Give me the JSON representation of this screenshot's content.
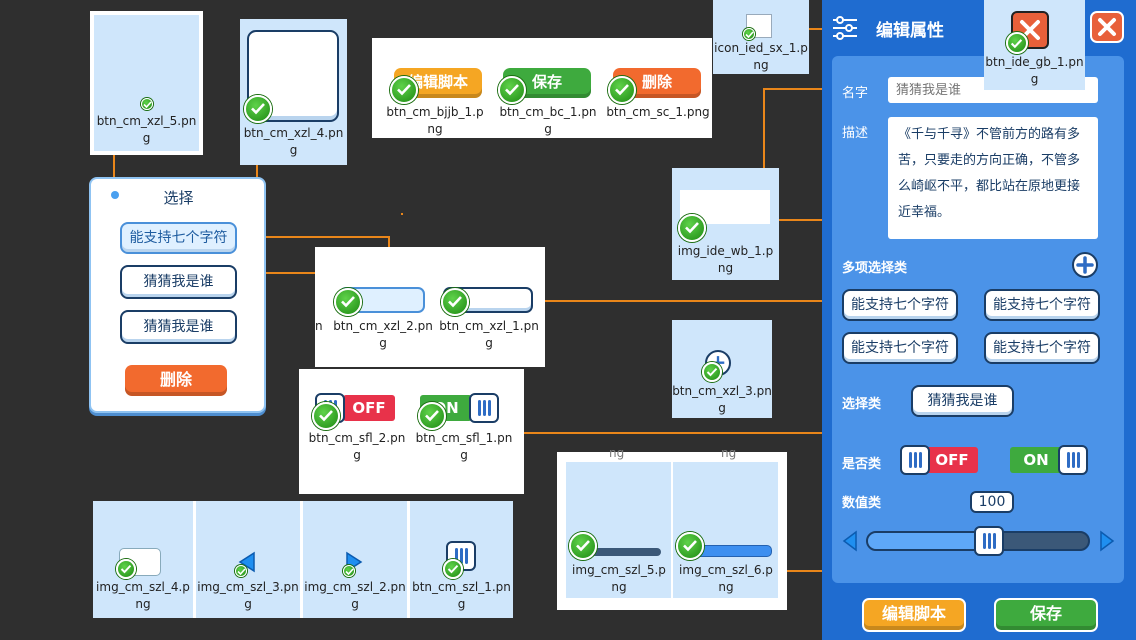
{
  "files": {
    "xzl5": "btn_cm_xzl_5.png",
    "xzl4": "btn_cm_xzl_4.png",
    "bjjb1": "btn_cm_bjjb_1.png",
    "bc1": "btn_cm_bc_1.png",
    "sc1": "btn_cm_sc_1.png",
    "iedsx1": "icon_ied_sx_1.png",
    "idegb1": "btn_ide_gb_1.png",
    "idewb1": "img_ide_wb_1.png",
    "xzl2": "btn_cm_xzl_2.png",
    "xzl1": "btn_cm_xzl_1.png",
    "xzl3": "btn_cm_xzl_3.png",
    "sfl2": "btn_cm_sfl_2.png",
    "sfl1": "btn_cm_sfl_1.png",
    "szl5": "img_cm_szl_5.png",
    "szl6": "img_cm_szl_6.png",
    "szl4": "img_cm_szl_4.png",
    "szl3": "img_cm_szl_3.png",
    "szl2": "img_cm_szl_2.png",
    "szl1": "btn_cm_szl_1.png"
  },
  "buttons": {
    "edit_script": "编辑脚本",
    "save": "保存",
    "delete": "删除",
    "off": "OFF",
    "on": "ON"
  },
  "popup": {
    "title": "选择",
    "options": [
      "能支持七个字符",
      "猜猜我是谁",
      "猜猜我是谁"
    ],
    "delete": "删除"
  },
  "panel": {
    "title": "编辑属性",
    "name_label": "名字",
    "name_placeholder": "猜猜我是谁",
    "desc_label": "描述",
    "desc_text": "《千与千寻》不管前方的路有多苦，只要走的方向正确，不管多么崎岖不平，都比站在原地更接近幸福。",
    "multi_label": "多项选择类",
    "multi_options": [
      "能支持七个字符",
      "能支持七个字符",
      "能支持七个字符",
      "能支持七个字符"
    ],
    "choice_label": "选择类",
    "choice_value": "猜猜我是谁",
    "bool_label": "是否类",
    "bool_off": "OFF",
    "bool_on": "ON",
    "num_label": "数值类",
    "num_value": "100",
    "slider_fraction": 0.55,
    "edit_script": "编辑脚本",
    "save": "保存"
  },
  "colors": {
    "background": "#2f2f2f",
    "panel": "#1f6cd0",
    "wire": "#e9861a",
    "tile": "#cfe6fb"
  }
}
